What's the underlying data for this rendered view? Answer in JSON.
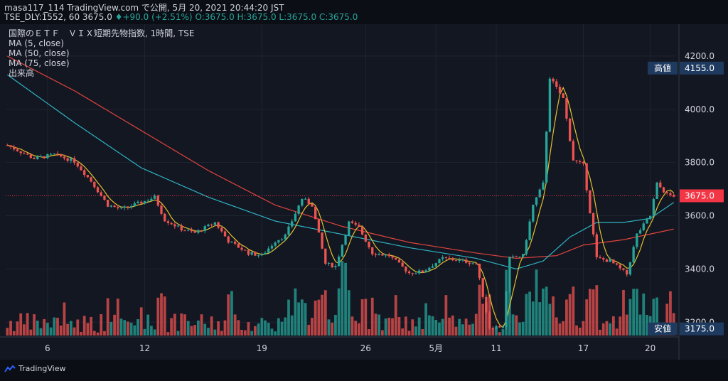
{
  "header": {
    "line1": "masa117_114 TradingView.com で公開, 5月 20, 2021 20:44:20 JST",
    "line2_prefix": "TSE_DLY:1552, 60 3675.0",
    "change": "+90.0 (+2.51%)",
    "ohlc": "O:3675.0 H:3675.0 L:3675.0 C:3675.0"
  },
  "legend": {
    "title": "国際のＥＴＦ　ＶＩＸ短期先物指数, 1時間, TSE",
    "ma5": "MA (5, close)",
    "ma50": "MA (50, close)",
    "ma75": "MA (75, close)",
    "volume": "出来高"
  },
  "tags": {
    "high_label": "高値",
    "high_value": "4155.0",
    "last_value": "3675.0",
    "low_label": "安値",
    "low_value": "3175.0"
  },
  "footer": {
    "brand": "TradingView"
  },
  "colors": {
    "up": "#26a69a",
    "down": "#ef5350",
    "ma5": "#e3c02f",
    "ma50": "#2fb3c2",
    "ma75": "#e0443c",
    "last": "#f23645",
    "tag": "#1e3a5f"
  },
  "chart_data": {
    "type": "candlestick",
    "y_ticks": [
      "3200.0",
      "3400.0",
      "3600.0",
      "3800.0",
      "4000.0",
      "4200.0"
    ],
    "y_tick_values": [
      3200,
      3400,
      3600,
      3800,
      4000,
      4200
    ],
    "ylim": [
      3150,
      4320
    ],
    "x_ticks": [
      "6",
      "12",
      "19",
      "26",
      "5月",
      "11",
      "17",
      "20"
    ],
    "x_tick_index": [
      12,
      41,
      76,
      107,
      128,
      146,
      172,
      192
    ],
    "bar_count": 200,
    "price_path": [
      {
        "i": 0,
        "v": 3865
      },
      {
        "i": 8,
        "v": 3815
      },
      {
        "i": 14,
        "v": 3830
      },
      {
        "i": 20,
        "v": 3805
      },
      {
        "i": 25,
        "v": 3730
      },
      {
        "i": 30,
        "v": 3640
      },
      {
        "i": 34,
        "v": 3625
      },
      {
        "i": 40,
        "v": 3650
      },
      {
        "i": 44,
        "v": 3670
      },
      {
        "i": 47,
        "v": 3585
      },
      {
        "i": 52,
        "v": 3550
      },
      {
        "i": 56,
        "v": 3535
      },
      {
        "i": 62,
        "v": 3575
      },
      {
        "i": 66,
        "v": 3505
      },
      {
        "i": 72,
        "v": 3460
      },
      {
        "i": 76,
        "v": 3450
      },
      {
        "i": 80,
        "v": 3505
      },
      {
        "i": 83,
        "v": 3525
      },
      {
        "i": 88,
        "v": 3665
      },
      {
        "i": 91,
        "v": 3640
      },
      {
        "i": 95,
        "v": 3420
      },
      {
        "i": 98,
        "v": 3410
      },
      {
        "i": 102,
        "v": 3575
      },
      {
        "i": 105,
        "v": 3555
      },
      {
        "i": 109,
        "v": 3460
      },
      {
        "i": 114,
        "v": 3450
      },
      {
        "i": 120,
        "v": 3385
      },
      {
        "i": 124,
        "v": 3390
      },
      {
        "i": 130,
        "v": 3440
      },
      {
        "i": 136,
        "v": 3430
      },
      {
        "i": 140,
        "v": 3420
      },
      {
        "i": 144,
        "v": 3180
      },
      {
        "i": 148,
        "v": 3185
      },
      {
        "i": 150,
        "v": 3440
      },
      {
        "i": 154,
        "v": 3450
      },
      {
        "i": 157,
        "v": 3640
      },
      {
        "i": 160,
        "v": 3720
      },
      {
        "i": 162,
        "v": 4120
      },
      {
        "i": 166,
        "v": 4040
      },
      {
        "i": 169,
        "v": 3810
      },
      {
        "i": 172,
        "v": 3790
      },
      {
        "i": 176,
        "v": 3440
      },
      {
        "i": 180,
        "v": 3430
      },
      {
        "i": 185,
        "v": 3380
      },
      {
        "i": 188,
        "v": 3530
      },
      {
        "i": 192,
        "v": 3600
      },
      {
        "i": 194,
        "v": 3720
      },
      {
        "i": 197,
        "v": 3680
      },
      {
        "i": 199,
        "v": 3675
      }
    ],
    "ma50_path": [
      {
        "i": 0,
        "v": 4130
      },
      {
        "i": 20,
        "v": 3950
      },
      {
        "i": 40,
        "v": 3780
      },
      {
        "i": 60,
        "v": 3670
      },
      {
        "i": 80,
        "v": 3580
      },
      {
        "i": 100,
        "v": 3530
      },
      {
        "i": 120,
        "v": 3480
      },
      {
        "i": 140,
        "v": 3440
      },
      {
        "i": 152,
        "v": 3400
      },
      {
        "i": 160,
        "v": 3430
      },
      {
        "i": 168,
        "v": 3520
      },
      {
        "i": 176,
        "v": 3575
      },
      {
        "i": 184,
        "v": 3575
      },
      {
        "i": 192,
        "v": 3590
      },
      {
        "i": 199,
        "v": 3650
      }
    ],
    "ma75_path": [
      {
        "i": 0,
        "v": 4200
      },
      {
        "i": 20,
        "v": 4070
      },
      {
        "i": 40,
        "v": 3920
      },
      {
        "i": 60,
        "v": 3770
      },
      {
        "i": 80,
        "v": 3640
      },
      {
        "i": 100,
        "v": 3560
      },
      {
        "i": 120,
        "v": 3500
      },
      {
        "i": 140,
        "v": 3460
      },
      {
        "i": 152,
        "v": 3440
      },
      {
        "i": 164,
        "v": 3450
      },
      {
        "i": 172,
        "v": 3490
      },
      {
        "i": 184,
        "v": 3510
      },
      {
        "i": 199,
        "v": 3550
      }
    ],
    "high": 4155.0,
    "low": 3175.0,
    "last": 3675.0
  }
}
